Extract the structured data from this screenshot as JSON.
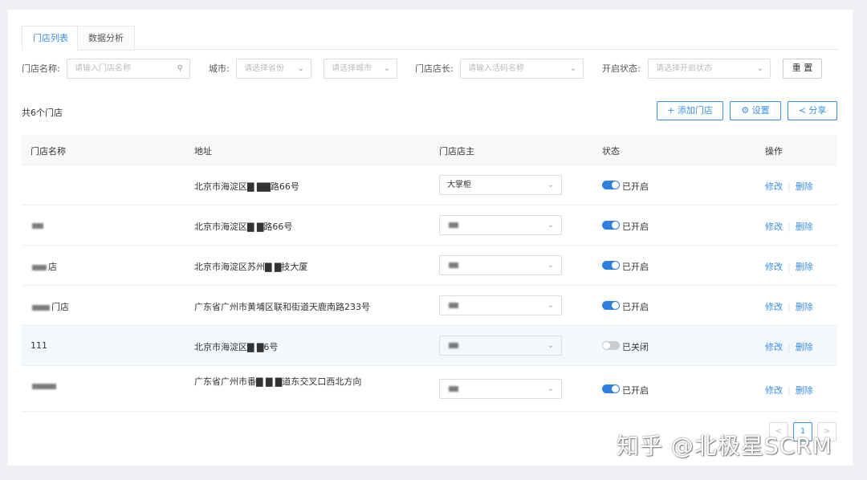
{
  "tabs": [
    "门店列表",
    "数据分析"
  ],
  "filters": {
    "name_label": "门店名称:",
    "name_placeholder": "请输入门店名称",
    "city_label": "城市:",
    "province_placeholder": "请选择省份",
    "city_placeholder": "请选择城市",
    "manager_label": "门店店长:",
    "manager_placeholder": "请输入活码名称",
    "status_label": "开启状态:",
    "status_placeholder": "请选择开启状态",
    "reset": "重 置"
  },
  "count": "共6个门店",
  "actions": {
    "add": "添加门店",
    "settings": "设置",
    "share": "分享"
  },
  "columns": [
    "门店名称",
    "地址",
    "门店店主",
    "状态",
    "操作"
  ],
  "rows": [
    {
      "name": "",
      "address": "北京市海淀区▇ ▇▇路66号",
      "owner": "大掌柜",
      "status": "已开启",
      "on": true
    },
    {
      "name": "",
      "address": "北京市海淀区▇ ▇路66号",
      "owner": "",
      "status": "已开启",
      "on": true
    },
    {
      "name": "店",
      "address": "北京市海淀区苏州▇ ▇技大厦",
      "owner": "",
      "status": "已开启",
      "on": true
    },
    {
      "name": "门店",
      "address": "广东省广州市黄埔区联和街道天鹿南路233号",
      "owner": "",
      "status": "已开启",
      "on": true
    },
    {
      "name": "111",
      "address": "北京市海淀区▇ ▇6号",
      "owner": "",
      "status": "已关闭",
      "on": false
    },
    {
      "name": "",
      "address": "广东省广州市番▇ ▇ ▇道东交叉口西北方向",
      "owner": "",
      "status": "已开启",
      "on": true
    }
  ],
  "op_edit": "修改",
  "op_delete": "删除",
  "pagination": {
    "prev": "<",
    "current": "1",
    "next": ">"
  },
  "watermark": "知乎 @北极星SCRM"
}
